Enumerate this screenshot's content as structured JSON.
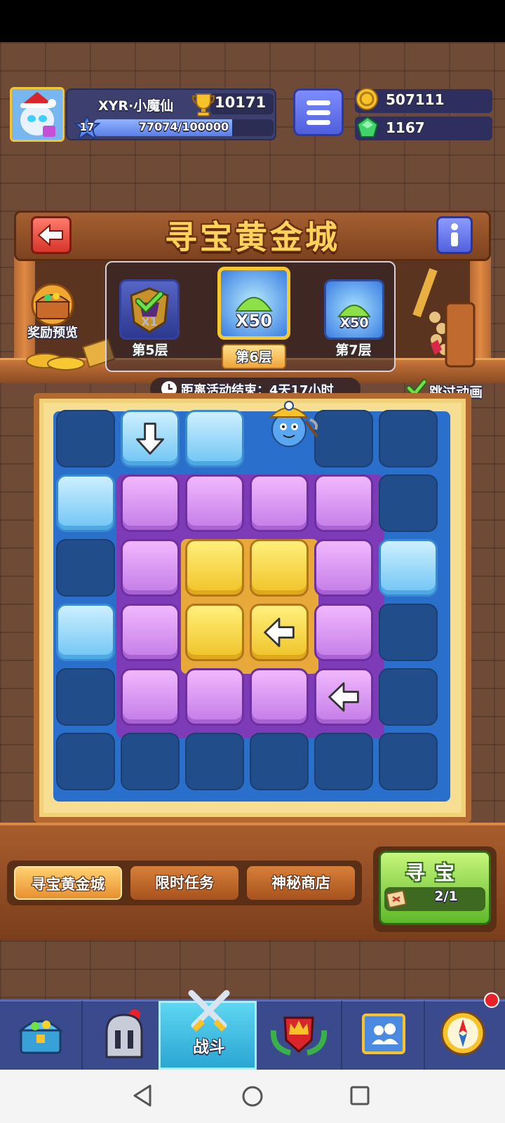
{
  "player": {
    "name": "XYR·小魔仙",
    "trophies": "10171",
    "level": "17",
    "xp_text": "77074/100000",
    "xp_fraction": 0.77
  },
  "currency": {
    "coins": "507111",
    "gems": "1167"
  },
  "event": {
    "title": "寻宝黄金城",
    "reward_preview_label": "奖励预览",
    "timer_text": "距离活动结束：4天17小时",
    "skip_label": "跳过动画",
    "skip_checked": true
  },
  "floors": [
    {
      "label": "第5层",
      "qty": "X1",
      "completed": true
    },
    {
      "label": "第6层",
      "qty": "X50",
      "current": true
    },
    {
      "label": "第7层",
      "qty": "X50"
    }
  ],
  "tabs": [
    "寻宝黄金城",
    "限时任务",
    "神秘商店"
  ],
  "search": {
    "label": "寻宝",
    "count": "2/1"
  },
  "nav": {
    "battle_label": "战斗"
  },
  "colors": {
    "accent_gold": "#f7c830",
    "board_blue": "#2a6fcc",
    "purple": "#7d3bb8"
  }
}
